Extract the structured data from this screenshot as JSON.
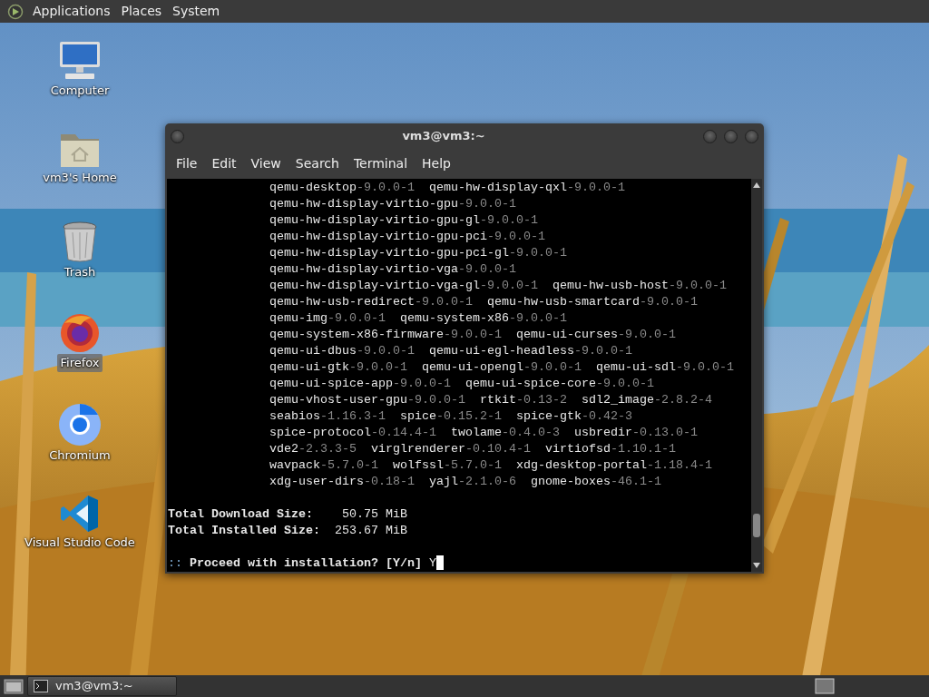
{
  "top_panel": {
    "menus": [
      "Applications",
      "Places",
      "System"
    ]
  },
  "desktop_icons": [
    {
      "label": "Computer",
      "kind": "computer",
      "selected": false
    },
    {
      "label": "vm3's Home",
      "kind": "home",
      "selected": false
    },
    {
      "label": "Trash",
      "kind": "trash",
      "selected": false
    },
    {
      "label": "Firefox",
      "kind": "firefox",
      "selected": true
    },
    {
      "label": "Chromium",
      "kind": "chromium",
      "selected": false
    },
    {
      "label": "Visual Studio Code",
      "kind": "vscode",
      "selected": false
    }
  ],
  "terminal": {
    "title": "vm3@vm3:~",
    "menu": [
      "File",
      "Edit",
      "View",
      "Search",
      "Terminal",
      "Help"
    ],
    "lines": [
      {
        "kind": "packages",
        "packages": [
          {
            "name": "qemu-desktop",
            "version": "-9.0.0-1"
          },
          {
            "name": "qemu-hw-display-qxl",
            "version": "-9.0.0-1"
          }
        ]
      },
      {
        "kind": "packages",
        "packages": [
          {
            "name": "qemu-hw-display-virtio-gpu",
            "version": "-9.0.0-1"
          }
        ]
      },
      {
        "kind": "packages",
        "packages": [
          {
            "name": "qemu-hw-display-virtio-gpu-gl",
            "version": "-9.0.0-1"
          }
        ]
      },
      {
        "kind": "packages",
        "packages": [
          {
            "name": "qemu-hw-display-virtio-gpu-pci",
            "version": "-9.0.0-1"
          }
        ]
      },
      {
        "kind": "packages",
        "packages": [
          {
            "name": "qemu-hw-display-virtio-gpu-pci-gl",
            "version": "-9.0.0-1"
          }
        ]
      },
      {
        "kind": "packages",
        "packages": [
          {
            "name": "qemu-hw-display-virtio-vga",
            "version": "-9.0.0-1"
          }
        ]
      },
      {
        "kind": "packages",
        "packages": [
          {
            "name": "qemu-hw-display-virtio-vga-gl",
            "version": "-9.0.0-1"
          },
          {
            "name": "qemu-hw-usb-host",
            "version": "-9.0.0-1"
          }
        ]
      },
      {
        "kind": "packages",
        "packages": [
          {
            "name": "qemu-hw-usb-redirect",
            "version": "-9.0.0-1"
          },
          {
            "name": "qemu-hw-usb-smartcard",
            "version": "-9.0.0-1"
          }
        ]
      },
      {
        "kind": "packages",
        "packages": [
          {
            "name": "qemu-img",
            "version": "-9.0.0-1"
          },
          {
            "name": "qemu-system-x86",
            "version": "-9.0.0-1"
          }
        ]
      },
      {
        "kind": "packages",
        "packages": [
          {
            "name": "qemu-system-x86-firmware",
            "version": "-9.0.0-1"
          },
          {
            "name": "qemu-ui-curses",
            "version": "-9.0.0-1"
          }
        ]
      },
      {
        "kind": "packages",
        "packages": [
          {
            "name": "qemu-ui-dbus",
            "version": "-9.0.0-1"
          },
          {
            "name": "qemu-ui-egl-headless",
            "version": "-9.0.0-1"
          }
        ]
      },
      {
        "kind": "packages",
        "packages": [
          {
            "name": "qemu-ui-gtk",
            "version": "-9.0.0-1"
          },
          {
            "name": "qemu-ui-opengl",
            "version": "-9.0.0-1"
          },
          {
            "name": "qemu-ui-sdl",
            "version": "-9.0.0-1"
          }
        ]
      },
      {
        "kind": "packages",
        "packages": [
          {
            "name": "qemu-ui-spice-app",
            "version": "-9.0.0-1"
          },
          {
            "name": "qemu-ui-spice-core",
            "version": "-9.0.0-1"
          }
        ]
      },
      {
        "kind": "packages",
        "packages": [
          {
            "name": "qemu-vhost-user-gpu",
            "version": "-9.0.0-1"
          },
          {
            "name": "rtkit",
            "version": "-0.13-2"
          },
          {
            "name": "sdl2_image",
            "version": "-2.8.2-4"
          }
        ]
      },
      {
        "kind": "packages",
        "packages": [
          {
            "name": "seabios",
            "version": "-1.16.3-1"
          },
          {
            "name": "spice",
            "version": "-0.15.2-1"
          },
          {
            "name": "spice-gtk",
            "version": "-0.42-3"
          }
        ]
      },
      {
        "kind": "packages",
        "packages": [
          {
            "name": "spice-protocol",
            "version": "-0.14.4-1"
          },
          {
            "name": "twolame",
            "version": "-0.4.0-3"
          },
          {
            "name": "usbredir",
            "version": "-0.13.0-1"
          }
        ]
      },
      {
        "kind": "packages",
        "packages": [
          {
            "name": "vde2",
            "version": "-2.3.3-5"
          },
          {
            "name": "virglrenderer",
            "version": "-0.10.4-1"
          },
          {
            "name": "virtiofsd",
            "version": "-1.10.1-1"
          }
        ]
      },
      {
        "kind": "packages",
        "packages": [
          {
            "name": "wavpack",
            "version": "-5.7.0-1"
          },
          {
            "name": "wolfssl",
            "version": "-5.7.0-1"
          },
          {
            "name": "xdg-desktop-portal",
            "version": "-1.18.4-1"
          }
        ]
      },
      {
        "kind": "packages",
        "packages": [
          {
            "name": "xdg-user-dirs",
            "version": "-0.18-1"
          },
          {
            "name": "yajl",
            "version": "-2.1.0-6"
          },
          {
            "name": "gnome-boxes",
            "version": "-46.1-1"
          }
        ]
      },
      {
        "kind": "blank"
      },
      {
        "kind": "summary",
        "label": "Total Download Size:",
        "value": "    50.75 MiB"
      },
      {
        "kind": "summary",
        "label": "Total Installed Size:",
        "value": "  253.67 MiB"
      },
      {
        "kind": "blank"
      },
      {
        "kind": "prompt",
        "marker": "::",
        "text": " Proceed with installation? [Y/n] ",
        "input": "Y"
      }
    ]
  },
  "taskbar": {
    "windows": [
      {
        "label": "vm3@vm3:~",
        "selected": true
      }
    ]
  }
}
